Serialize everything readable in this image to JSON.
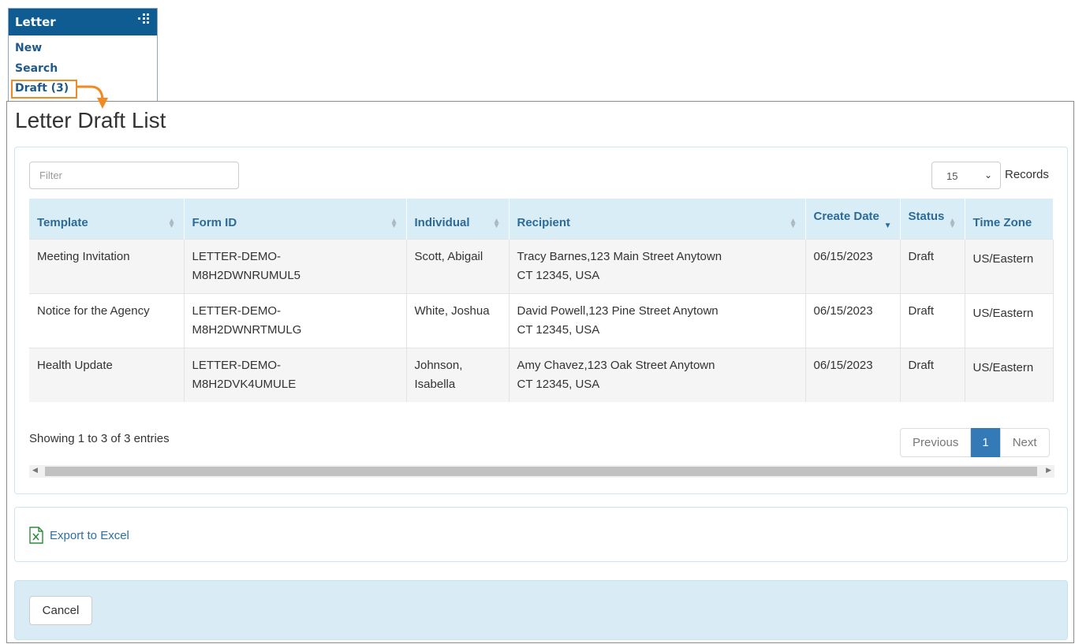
{
  "menu": {
    "title": "Letter",
    "items": [
      {
        "label": "New"
      },
      {
        "label": "Search"
      },
      {
        "label": "Draft (3)"
      }
    ]
  },
  "page": {
    "title": "Letter Draft List"
  },
  "filter": {
    "placeholder": "Filter",
    "value": ""
  },
  "records": {
    "selected": "15",
    "label": "Records"
  },
  "table": {
    "columns": [
      "Template",
      "Form ID",
      "Individual",
      "Recipient",
      "Create Date",
      "Status",
      "Time Zone"
    ],
    "rows": [
      {
        "template": "Meeting Invitation",
        "form_id": "LETTER-DEMO-\nM8H2DWNRUMUL5",
        "individual": "Scott, Abigail",
        "recipient": "Tracy Barnes,123 Main Street Anytown\nCT 12345, USA",
        "create_date": "06/15/2023",
        "status": "Draft",
        "time_zone": "US/Eastern"
      },
      {
        "template": "Notice for the Agency",
        "form_id": "LETTER-DEMO-\nM8H2DWNRTMULG",
        "individual": "White, Joshua",
        "recipient": "David Powell,123 Pine Street Anytown\nCT 12345, USA",
        "create_date": "06/15/2023",
        "status": "Draft",
        "time_zone": "US/Eastern"
      },
      {
        "template": "Health Update",
        "form_id": "LETTER-DEMO-\nM8H2DVK4UMULE",
        "individual": "Johnson,\nIsabella",
        "recipient": "Amy Chavez,123 Oak Street Anytown\nCT 12345, USA",
        "create_date": "06/15/2023",
        "status": "Draft",
        "time_zone": "US/Eastern"
      }
    ]
  },
  "footer": {
    "showing": "Showing 1 to 3 of 3 entries",
    "pagination": {
      "previous": "Previous",
      "current": "1",
      "next": "Next"
    }
  },
  "export": {
    "label": "Export to Excel"
  },
  "actions": {
    "cancel": "Cancel"
  },
  "colors": {
    "menu_header": "#0f5c93",
    "highlight": "#f08a24",
    "table_header": "#d9edf7",
    "link": "#2b6fa6",
    "page_active": "#337ab7"
  },
  "icons": {
    "menu_grid": "grid-icon",
    "excel": "excel-icon",
    "sort": "sort-icon",
    "callout_arrow": "callout-arrow-icon"
  }
}
